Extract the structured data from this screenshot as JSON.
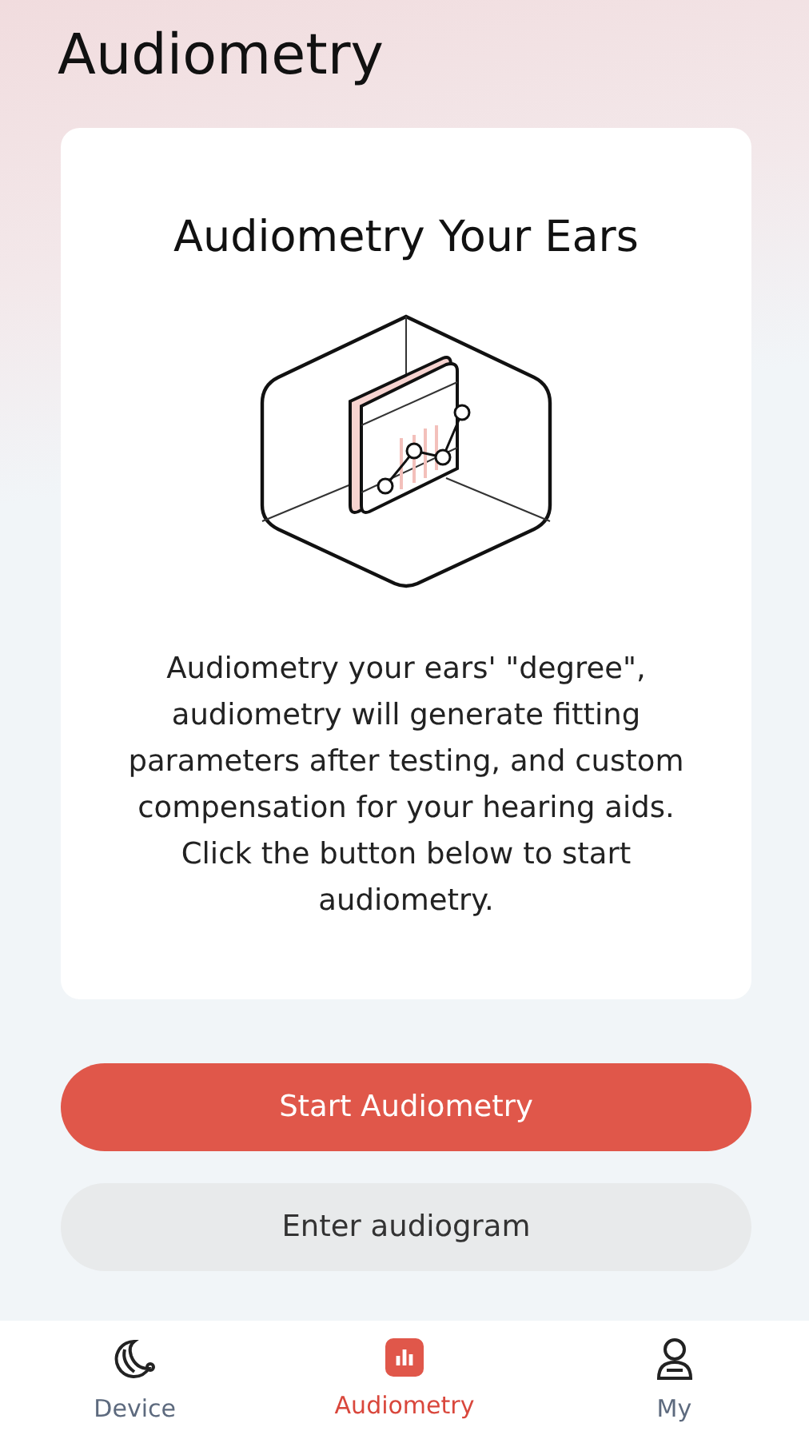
{
  "header": {
    "title": "Audiometry"
  },
  "card": {
    "title": "Audiometry Your Ears",
    "description": "Audiometry your ears' \"degree\", audiometry will generate fitting parameters after testing, and custom compensation for your hearing aids. Click the button below to start audiometry."
  },
  "buttons": [
    {
      "label": "Start Audiometry",
      "kind": "primary"
    },
    {
      "label": "Enter audiogram",
      "kind": "secondary"
    }
  ],
  "tabs": [
    {
      "label": "Device",
      "kind": "device",
      "selected": false
    },
    {
      "label": "Audiometry",
      "kind": "audiometry",
      "selected": true
    },
    {
      "label": "My",
      "kind": "profile",
      "selected": false
    }
  ]
}
